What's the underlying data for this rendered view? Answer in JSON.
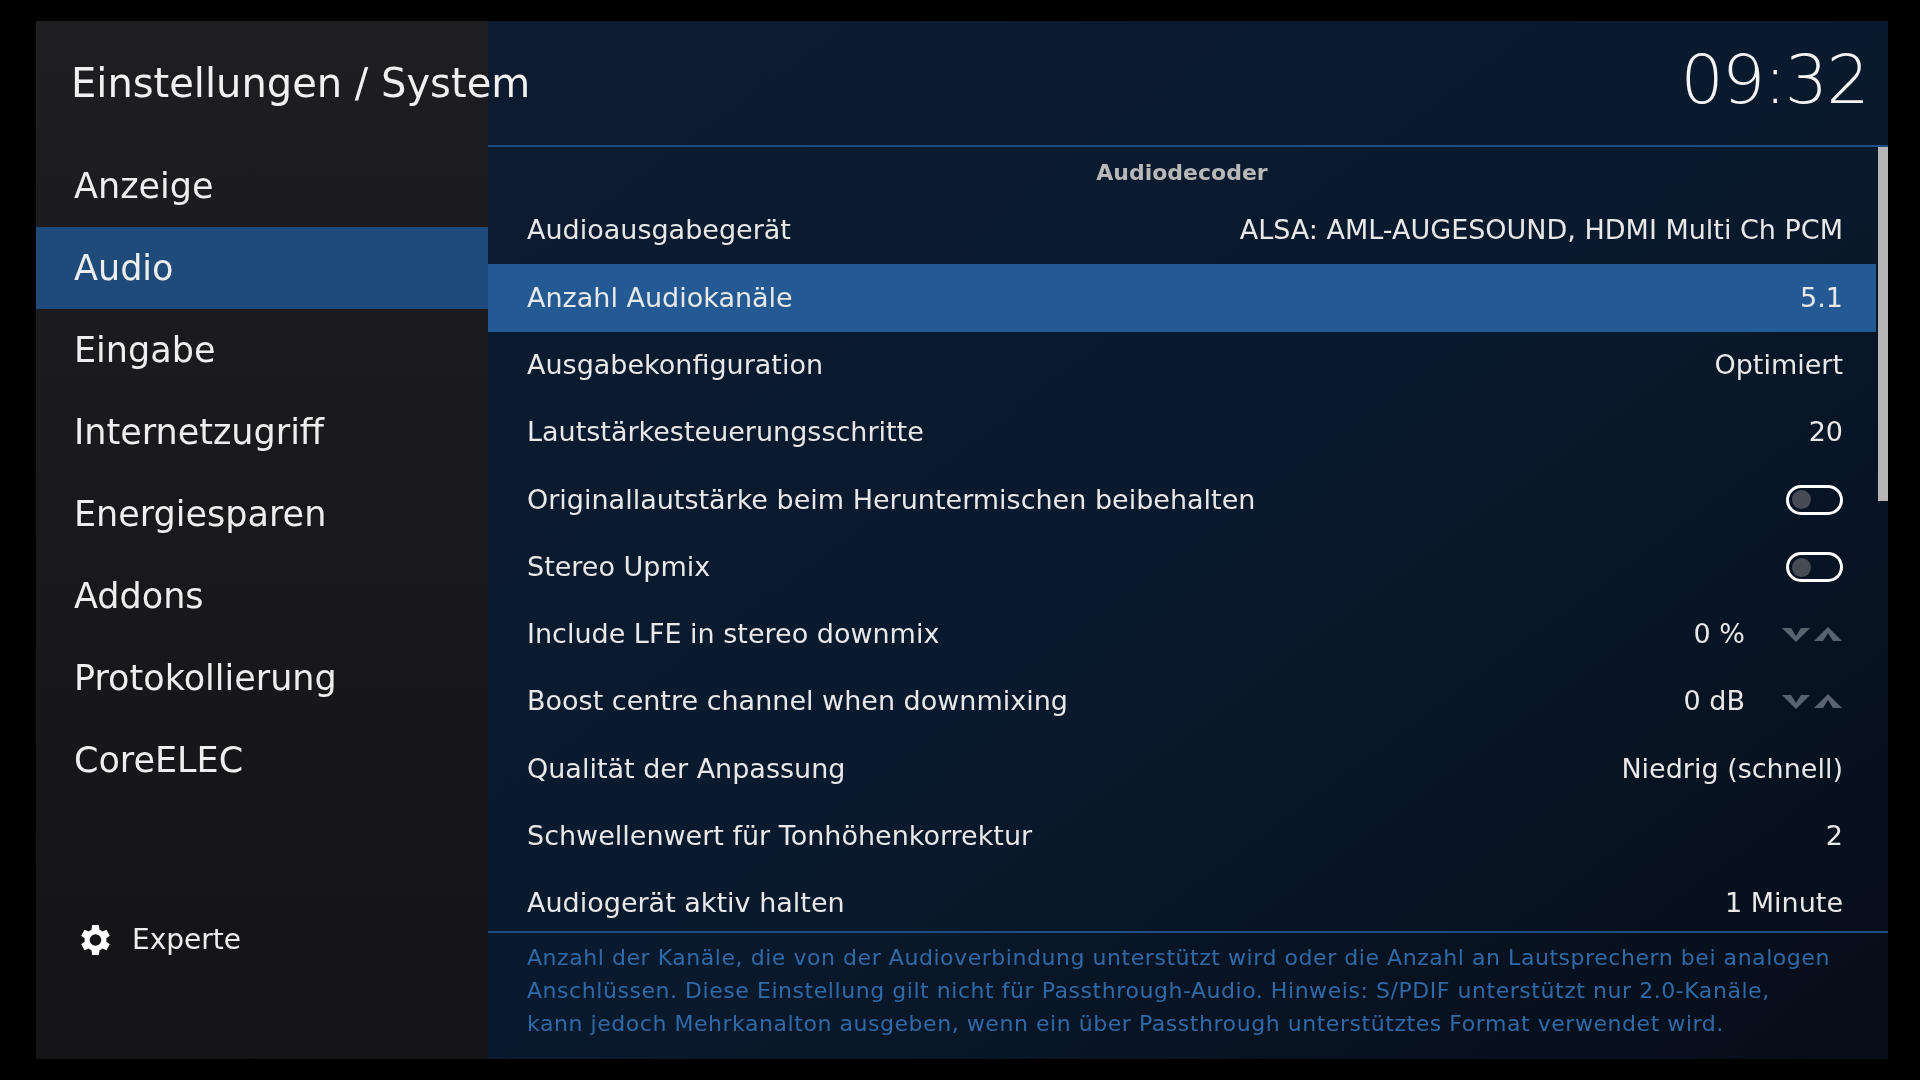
{
  "header": {
    "title": "Einstellungen / System",
    "clock": "09:32"
  },
  "sidebar": {
    "items": [
      {
        "label": "Anzeige",
        "selected": false
      },
      {
        "label": "Audio",
        "selected": true
      },
      {
        "label": "Eingabe",
        "selected": false
      },
      {
        "label": "Internetzugriff",
        "selected": false
      },
      {
        "label": "Energiesparen",
        "selected": false
      },
      {
        "label": "Addons",
        "selected": false
      },
      {
        "label": "Protokollierung",
        "selected": false
      },
      {
        "label": "CoreELEC",
        "selected": false
      }
    ],
    "level_button": {
      "label": "Experte"
    }
  },
  "settings": {
    "section": "Audiodecoder",
    "rows": [
      {
        "kind": "value",
        "label": "Audioausgabegerät",
        "value": "ALSA: AML-AUGESOUND, HDMI Multi Ch PCM",
        "selected": false
      },
      {
        "kind": "value",
        "label": "Anzahl Audiokanäle",
        "value": "5.1",
        "selected": true
      },
      {
        "kind": "value",
        "label": "Ausgabekonfiguration",
        "value": "Optimiert",
        "selected": false
      },
      {
        "kind": "value",
        "label": "Lautstärkesteuerungsschritte",
        "value": "20",
        "selected": false
      },
      {
        "kind": "toggle",
        "label": "Originallautstärke beim Heruntermischen beibehalten",
        "on": false,
        "selected": false
      },
      {
        "kind": "toggle",
        "label": "Stereo Upmix",
        "on": false,
        "selected": false
      },
      {
        "kind": "spinner",
        "label": "Include LFE in stereo downmix",
        "value": "0 %",
        "selected": false
      },
      {
        "kind": "spinner",
        "label": "Boost centre channel when downmixing",
        "value": "0 dB",
        "selected": false
      },
      {
        "kind": "value",
        "label": "Qualität der Anpassung",
        "value": "Niedrig (schnell)",
        "selected": false
      },
      {
        "kind": "value",
        "label": "Schwellenwert für Tonhöhenkorrektur",
        "value": "2",
        "selected": false
      },
      {
        "kind": "value",
        "label": "Audiogerät aktiv halten",
        "value": "1 Minute",
        "selected": false
      }
    ]
  },
  "description": "Anzahl der Kanäle, die von der Audioverbindung unterstützt wird oder die Anzahl an Lautsprechern bei analogen Anschlüssen. Diese Einstellung gilt nicht für Passthrough-Audio. Hinweis: S/PDIF unterstützt nur 2.0-Kanäle, kann jedoch Mehrkanalton ausgeben, wenn ein über Passthrough unterstütztes Format verwendet wird."
}
